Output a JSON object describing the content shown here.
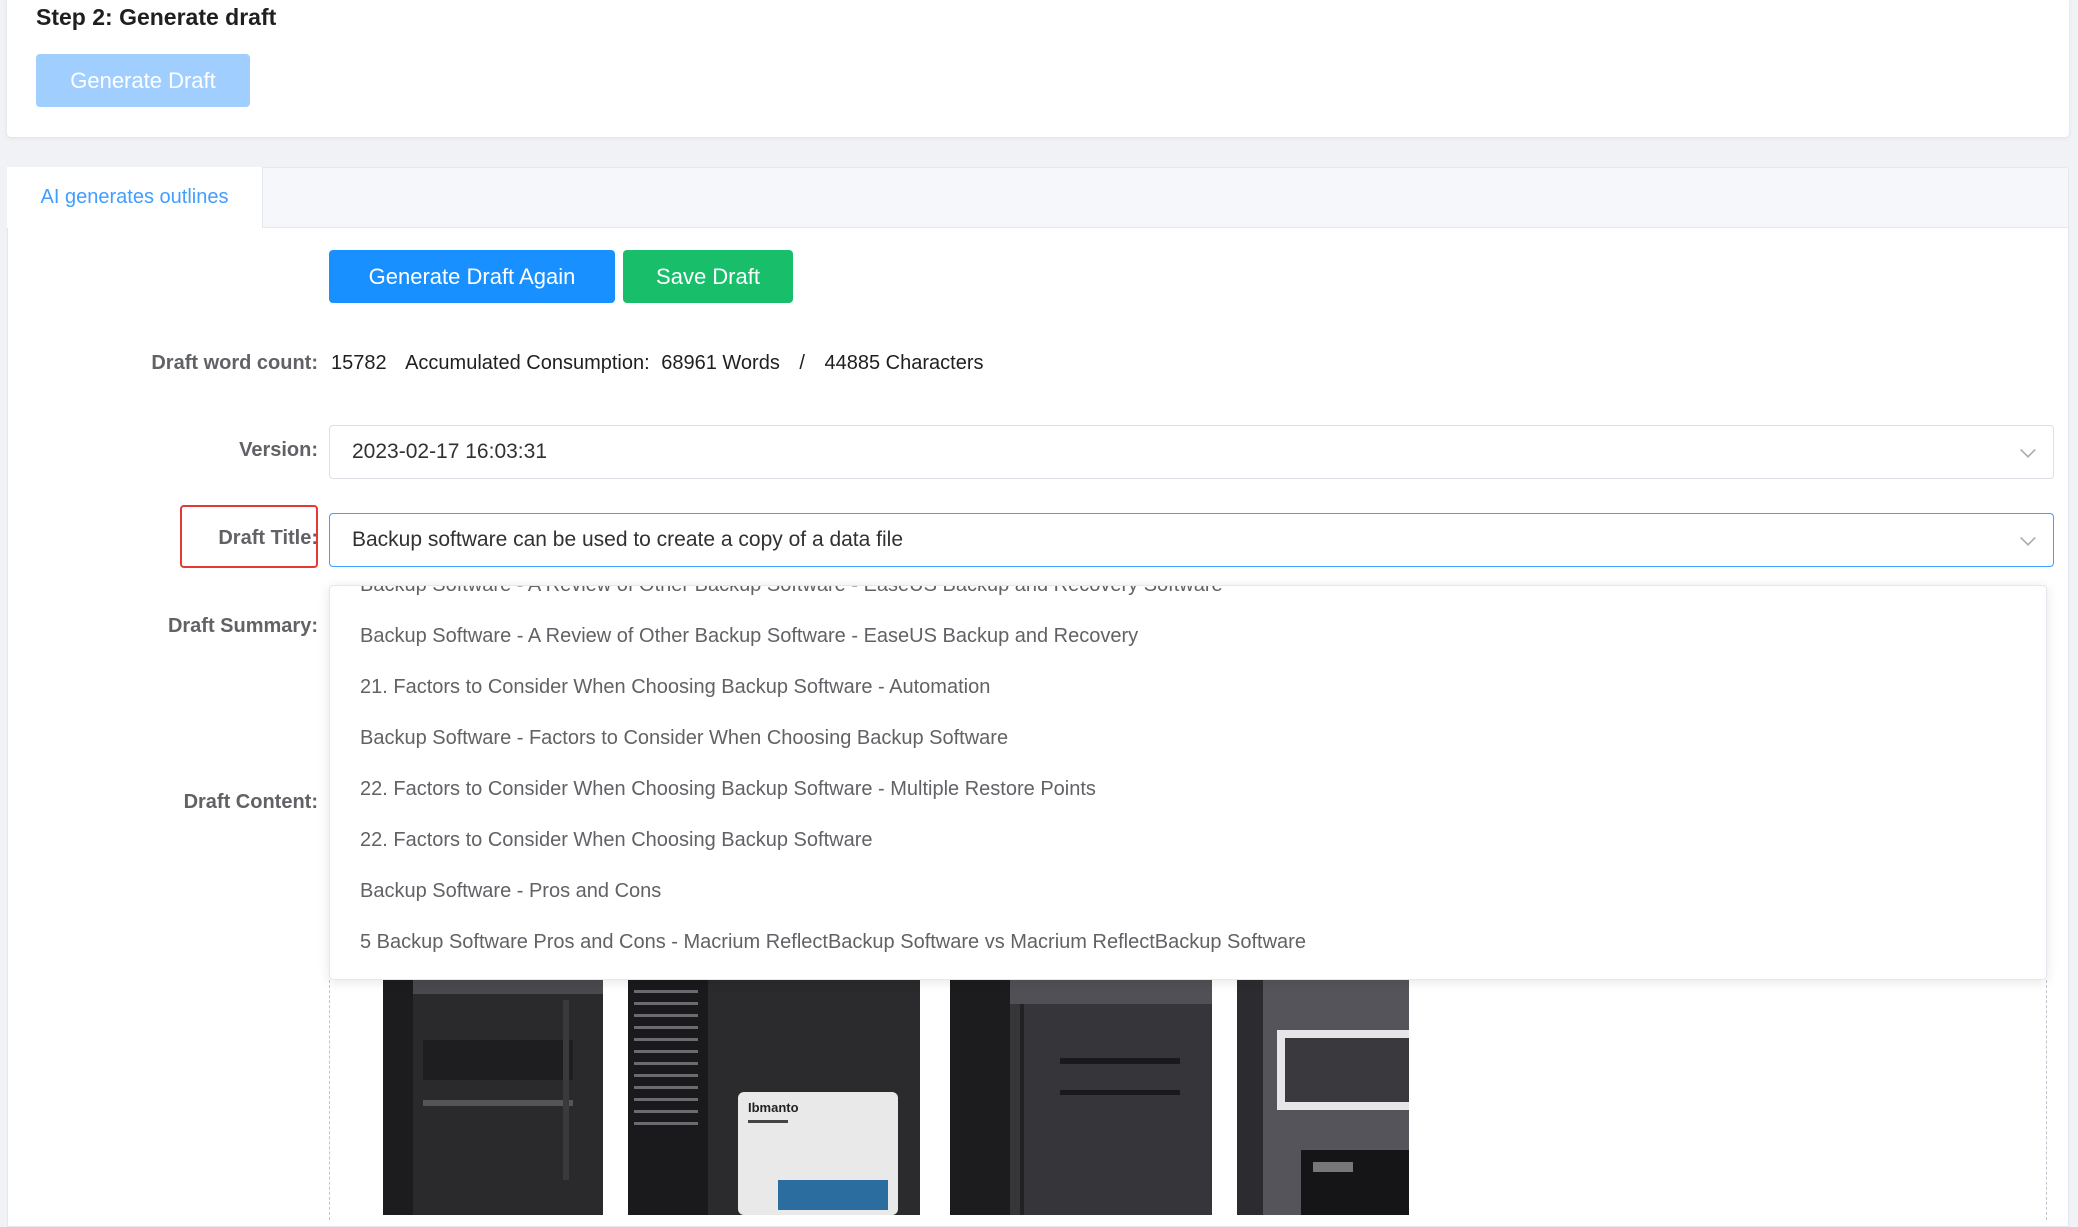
{
  "step": {
    "title": "Step 2: Generate draft",
    "generate_button": "Generate Draft"
  },
  "tabs": [
    {
      "label": "AI generates outlines",
      "active": true
    }
  ],
  "actions": {
    "generate_again": "Generate Draft Again",
    "save": "Save Draft"
  },
  "word_count": {
    "label": "Draft word count:",
    "count": "15782",
    "consumption_label": "Accumulated Consumption:",
    "words": "68961 Words",
    "separator": "/",
    "characters": "44885 Characters"
  },
  "version": {
    "label": "Version:",
    "value": "2023-02-17 16:03:31"
  },
  "draft_title": {
    "label": "Draft Title:",
    "value": "Backup software can be used to create a copy of a data file",
    "options": [
      "Backup Software - A Review of Other Backup Software - EaseUS Backup and Recovery Software",
      "Backup Software - A Review of Other Backup Software - EaseUS Backup and Recovery",
      "21. Factors to Consider When Choosing Backup Software - Automation",
      "Backup Software - Factors to Consider When Choosing Backup Software",
      "22. Factors to Consider When Choosing Backup Software - Multiple Restore Points",
      "22. Factors to Consider When Choosing Backup Software",
      "Backup Software - Pros and Cons",
      "5 Backup Software Pros and Cons - Macrium ReflectBackup Software vs Macrium ReflectBackup Software"
    ]
  },
  "draft_summary": {
    "label": "Draft Summary:"
  },
  "draft_content": {
    "label": "Draft Content:",
    "image_text": "Ibmanto"
  },
  "colors": {
    "primary": "#1890ff",
    "success": "#19be6b",
    "disabled": "#a0cfff",
    "tab_active": "#409eff",
    "highlight": "#e53935"
  }
}
